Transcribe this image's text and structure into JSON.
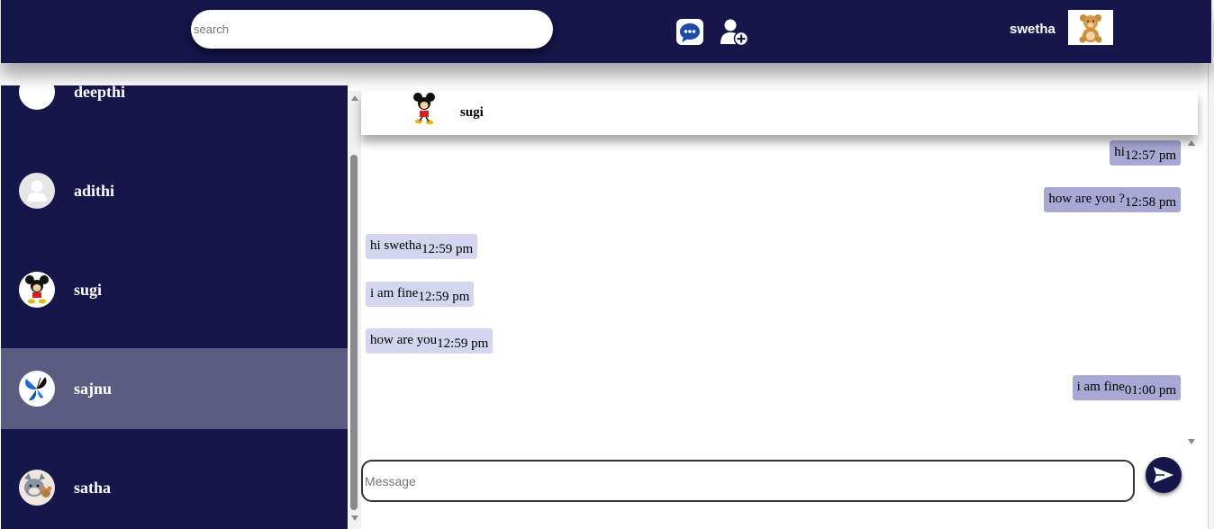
{
  "header": {
    "search_placeholder": "search",
    "chat_icon": "chat-bubble-icon",
    "add_user_icon": "add-user-icon",
    "user_name": "swetha",
    "user_avatar_icon": "teddy-bear-avatar"
  },
  "sidebar": {
    "contacts": [
      {
        "name": "deepthi",
        "avatar": "blank-avatar"
      },
      {
        "name": "adithi",
        "avatar": "default-user-avatar"
      },
      {
        "name": "sugi",
        "avatar": "mickey-avatar"
      },
      {
        "name": "sajnu",
        "avatar": "butterfly-avatar",
        "active": true
      },
      {
        "name": "satha",
        "avatar": "tom-jerry-avatar"
      }
    ]
  },
  "chat": {
    "contact_name": "sugi",
    "contact_avatar": "mickey-avatar",
    "messages": [
      {
        "text": "hi",
        "time": "12:57 pm",
        "direction": "out"
      },
      {
        "text": "how are you ?",
        "time": "12:58 pm",
        "direction": "out"
      },
      {
        "text": "hi swetha",
        "time": "12:59 pm",
        "direction": "in"
      },
      {
        "text": "i am fine",
        "time": "12:59 pm",
        "direction": "in"
      },
      {
        "text": "how are you",
        "time": "12:59 pm",
        "direction": "in"
      },
      {
        "text": "i am fine",
        "time": "01:00 pm",
        "direction": "out"
      }
    ],
    "message_placeholder": "Message",
    "send_icon": "send-icon"
  },
  "colors": {
    "navy": "#15164a",
    "active_contact": "#5b5c82",
    "outgoing_bubble": "#a9a7d4",
    "incoming_bubble": "#d4d6f0"
  }
}
